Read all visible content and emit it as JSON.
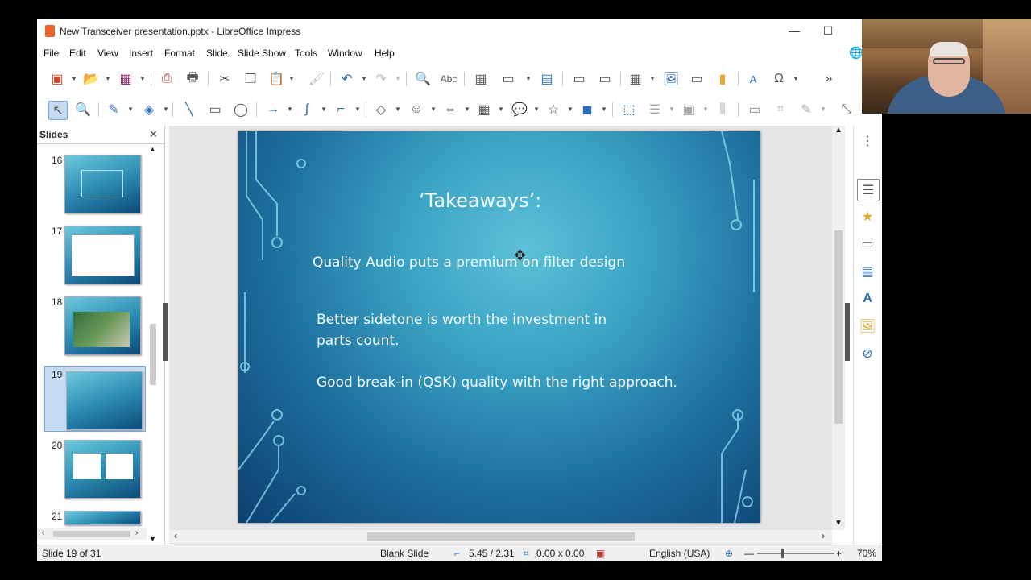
{
  "window": {
    "title": "New Transceiver presentation.pptx - LibreOffice Impress"
  },
  "menu": [
    "File",
    "Edit",
    "View",
    "Insert",
    "Format",
    "Slide",
    "Slide Show",
    "Tools",
    "Window",
    "Help"
  ],
  "slides_panel": {
    "title": "Slides",
    "thumbnails": [
      {
        "num": "16"
      },
      {
        "num": "17"
      },
      {
        "num": "18"
      },
      {
        "num": "19",
        "selected": true
      },
      {
        "num": "20"
      },
      {
        "num": "21"
      }
    ]
  },
  "slide": {
    "title": "‘Takeaways’:",
    "line1": "Quality Audio puts a premium on filter design",
    "line2a": "Better sidetone is worth the investment in",
    "line2b": "parts count.",
    "line3": "Good break-in (QSK) quality with the right approach."
  },
  "statusbar": {
    "slide": "Slide 19 of 31",
    "layout": "Blank Slide",
    "position": "5.45 / 2.31",
    "size": "0.00 x 0.00",
    "language": "English (USA)",
    "zoom": "70%"
  },
  "icons": [
    "new-icon",
    "open-icon",
    "save-icon",
    "pdf-icon",
    "print-icon",
    "cut-icon",
    "copy-icon",
    "paste-icon",
    "clone-icon",
    "undo-icon",
    "redo-icon",
    "find-icon",
    "spellcheck-icon",
    "grid-icon",
    "display-views-icon",
    "master-icon",
    "start-show-icon",
    "table-icon",
    "image-icon",
    "media-icon",
    "chart-icon",
    "textbox-icon",
    "special-char-icon"
  ]
}
